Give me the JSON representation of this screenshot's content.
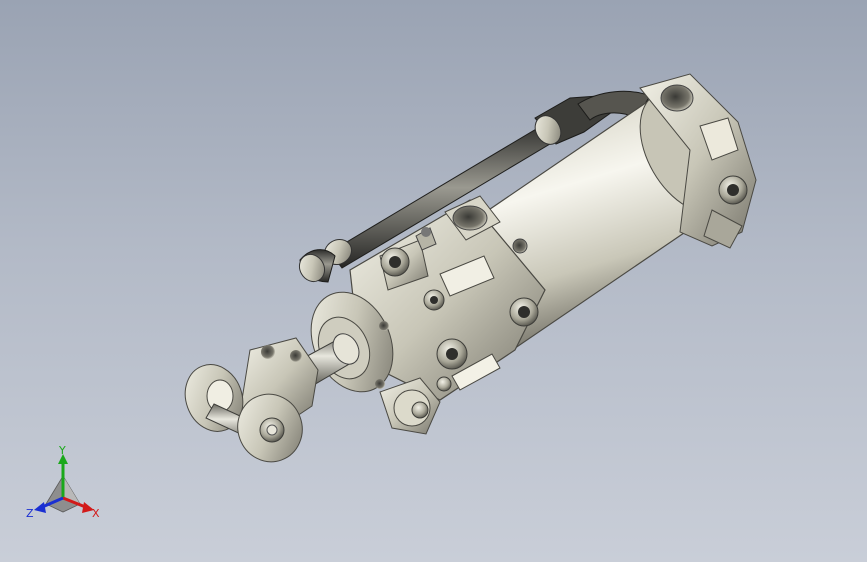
{
  "viewport": {
    "background_top": "#9aa3b3",
    "background_bottom": "#c9ced8"
  },
  "model": {
    "icon": "pneumatic-cylinder-clamp-model",
    "body_color": "#d8d6c8",
    "shadow_color": "#5f5e55",
    "highlight_color": "#f6f5ee"
  },
  "triad": {
    "x_label": "X",
    "y_label": "Y",
    "z_label": "Z",
    "x_color": "#d21a1a",
    "y_color": "#1aa81a",
    "z_color": "#1a2fd2"
  }
}
